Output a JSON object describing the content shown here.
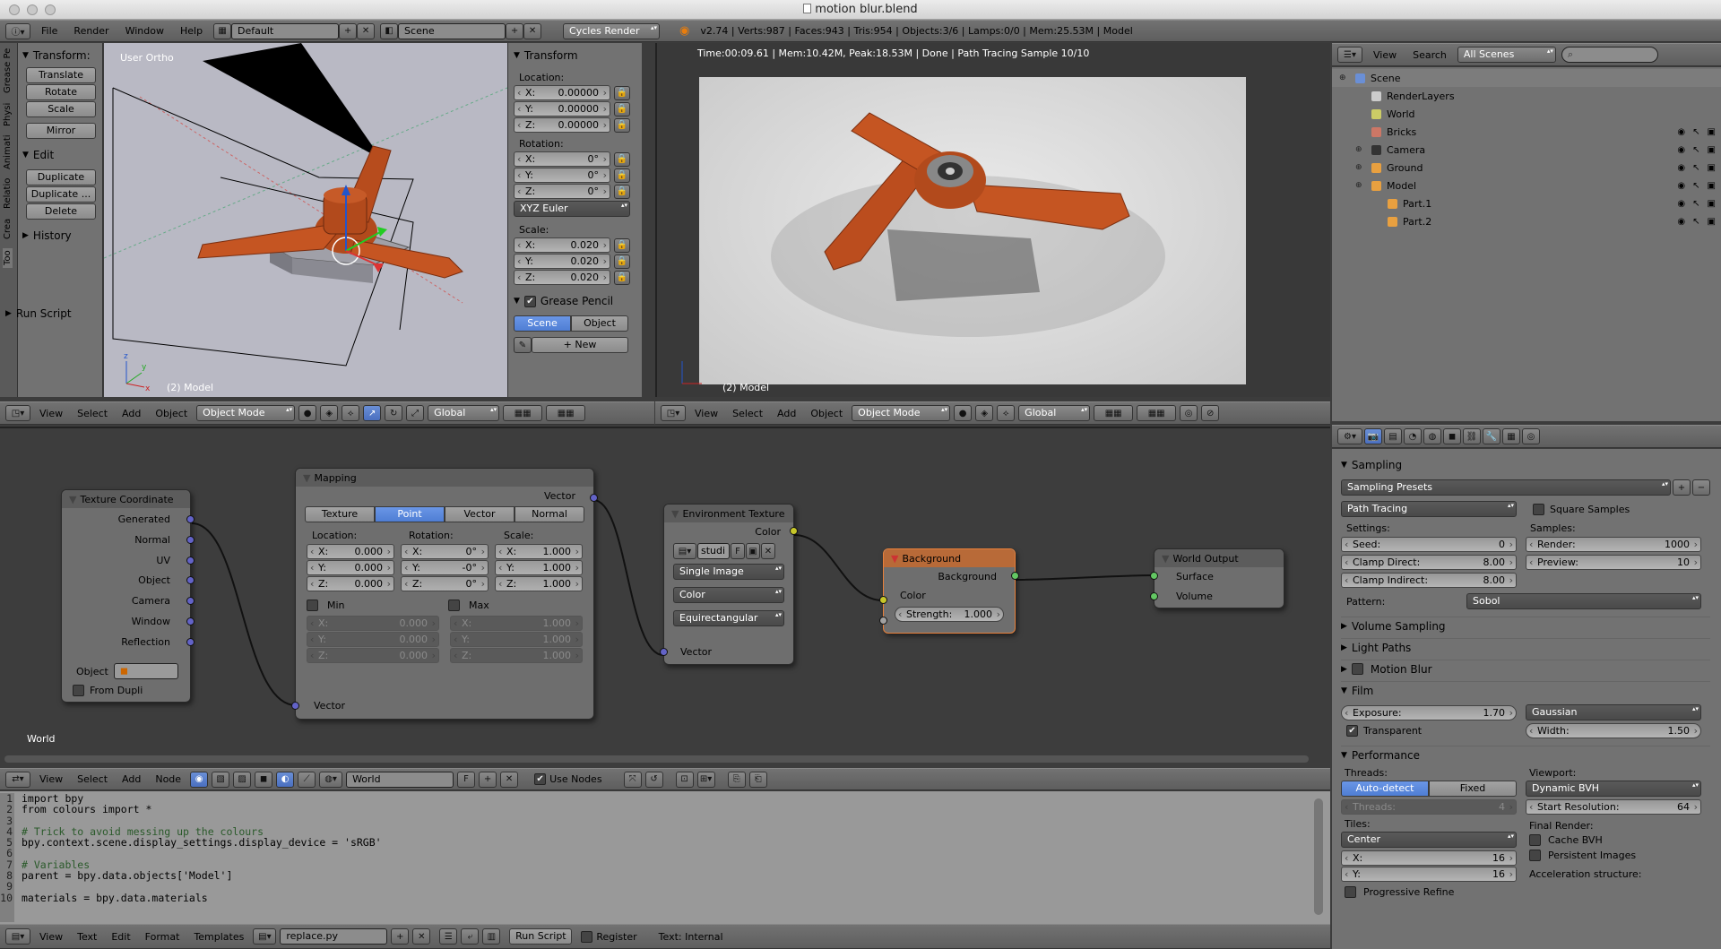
{
  "window_title": "motion blur.blend",
  "info_bar": {
    "menus": [
      "File",
      "Render",
      "Window",
      "Help"
    ],
    "layout": "Default",
    "scene": "Scene",
    "engine": "Cycles Render",
    "stats": "v2.74 | Verts:987 | Faces:943 | Tris:954 | Objects:3/6 | Lamps:0/0 | Mem:25.53M | Model"
  },
  "left_tabs": [
    "Too",
    "Crea",
    "Relatio",
    "Animati",
    "Physi",
    "Grease Pe"
  ],
  "tool_shelf": {
    "transform_header": "Transform:",
    "transform_buttons": [
      "Translate",
      "Rotate",
      "Scale",
      "Mirror"
    ],
    "edit_header": "Edit",
    "edit_buttons": [
      "Duplicate",
      "Duplicate ...",
      "Delete"
    ],
    "history_header": "History",
    "run_script": "Run Script"
  },
  "viewport3d": {
    "label": "User Ortho",
    "object_label": "(2) Model"
  },
  "n_panel": {
    "transform_title": "Transform",
    "location_label": "Location:",
    "location": [
      "0.00000",
      "0.00000",
      "0.00000"
    ],
    "rotation_label": "Rotation:",
    "rotation": [
      "0°",
      "0°",
      "0°"
    ],
    "rotation_mode": "XYZ Euler",
    "scale_label": "Scale:",
    "scale": [
      "0.020",
      "0.020",
      "0.020"
    ],
    "axes": [
      "X:",
      "Y:",
      "Z:"
    ],
    "grease_title": "Grease Pencil",
    "scene_btn": "Scene",
    "object_btn": "Object",
    "new_btn": "New"
  },
  "render_view": {
    "status": "Time:00:09.61 | Mem:10.42M, Peak:18.53M | Done | Path Tracing Sample 10/10",
    "object_label": "(2) Model"
  },
  "view3d_header": {
    "menus": [
      "View",
      "Select",
      "Add",
      "Object"
    ],
    "mode": "Object Mode",
    "orientation": "Global"
  },
  "outliner": {
    "menus": [
      "View",
      "Search"
    ],
    "filter": "All Scenes",
    "items": [
      {
        "label": "Scene",
        "depth": 0,
        "color": "#6a8fd6"
      },
      {
        "label": "RenderLayers",
        "depth": 1,
        "color": "#ccc"
      },
      {
        "label": "World",
        "depth": 1,
        "color": "#cc6"
      },
      {
        "label": "Bricks",
        "depth": 1,
        "color": "#c76"
      },
      {
        "label": "Camera",
        "depth": 1,
        "color": "#333"
      },
      {
        "label": "Ground",
        "depth": 1,
        "color": "#e8a040"
      },
      {
        "label": "Model",
        "depth": 1,
        "color": "#e8a040"
      },
      {
        "label": "Part.1",
        "depth": 2,
        "color": "#e8a040"
      },
      {
        "label": "Part.2",
        "depth": 2,
        "color": "#e8a040"
      }
    ]
  },
  "nodes": {
    "tex_coord": {
      "title": "Texture Coordinate",
      "outputs": [
        "Generated",
        "Normal",
        "UV",
        "Object",
        "Camera",
        "Window",
        "Reflection"
      ],
      "object_label": "Object",
      "from_dupli": "From Dupli"
    },
    "mapping": {
      "title": "Mapping",
      "out": "Vector",
      "tabs": [
        "Texture",
        "Point",
        "Vector",
        "Normal"
      ],
      "loc_label": "Location:",
      "rot_label": "Rotation:",
      "scale_label": "Scale:",
      "loc": [
        "0.000",
        "0.000",
        "0.000"
      ],
      "rot": [
        "0°",
        "-0°",
        "0°"
      ],
      "scale": [
        "1.000",
        "1.000",
        "1.000"
      ],
      "min_label": "Min",
      "max_label": "Max",
      "min": [
        "0.000",
        "0.000",
        "0.000"
      ],
      "max": [
        "1.000",
        "1.000",
        "1.000"
      ],
      "in": "Vector"
    },
    "env": {
      "title": "Environment Texture",
      "out": "Color",
      "image": "studi",
      "f": "F",
      "proj": "Single Image",
      "color": "Color",
      "mapping": "Equirectangular",
      "in": "Vector"
    },
    "bg": {
      "title": "Background",
      "out": "Background",
      "color": "Color",
      "strength_label": "Strength:",
      "strength": "1.000"
    },
    "world_out": {
      "title": "World Output",
      "surface": "Surface",
      "volume": "Volume"
    },
    "context_label": "World"
  },
  "node_header": {
    "menus": [
      "View",
      "Select",
      "Add",
      "Node"
    ],
    "world": "World",
    "f": "F",
    "use_nodes": "Use Nodes"
  },
  "text_editor": {
    "lines": [
      "import bpy",
      "from colours import *",
      "",
      "# Trick to avoid messing up the colours",
      "bpy.context.scene.display_settings.display_device = 'sRGB'",
      "",
      "# Variables",
      "parent = bpy.data.objects['Model']",
      "",
      "materials = bpy.data.materials"
    ],
    "menus": [
      "View",
      "Text",
      "Edit",
      "Format",
      "Templates"
    ],
    "file": "replace.py",
    "run_script": "Run Script",
    "register": "Register",
    "internal": "Text: Internal"
  },
  "properties": {
    "sampling_title": "Sampling",
    "presets": "Sampling Presets",
    "method": "Path Tracing",
    "square": "Square Samples",
    "settings_label": "Settings:",
    "samples_label": "Samples:",
    "seed_label": "Seed:",
    "seed": "0",
    "clamp_direct_label": "Clamp Direct:",
    "clamp_direct": "8.00",
    "clamp_indirect_label": "Clamp Indirect:",
    "clamp_indirect": "8.00",
    "render_label": "Render:",
    "render": "1000",
    "preview_label": "Preview:",
    "preview": "10",
    "pattern_label": "Pattern:",
    "pattern": "Sobol",
    "volume_sampling": "Volume Sampling",
    "light_paths": "Light Paths",
    "motion_blur": "Motion Blur",
    "film_title": "Film",
    "exposure_label": "Exposure:",
    "exposure": "1.70",
    "filter": "Gaussian",
    "transparent": "Transparent",
    "width_label": "Width:",
    "width": "1.50",
    "perf_title": "Performance",
    "threads_label": "Threads:",
    "auto": "Auto-detect",
    "fixed": "Fixed",
    "threads_field": "Threads:",
    "threads": "4",
    "viewport_label": "Viewport:",
    "bvh": "Dynamic BVH",
    "start_res_label": "Start Resolution:",
    "start_res": "64",
    "tiles_label": "Tiles:",
    "tiles": "Center",
    "final_render": "Final Render:",
    "cache_bvh": "Cache BVH",
    "persistent": "Persistent Images",
    "tx_label": "X:",
    "tx": "16",
    "ty_label": "Y:",
    "ty": "16",
    "progressive": "Progressive Refine",
    "accel": "Acceleration structure:"
  }
}
